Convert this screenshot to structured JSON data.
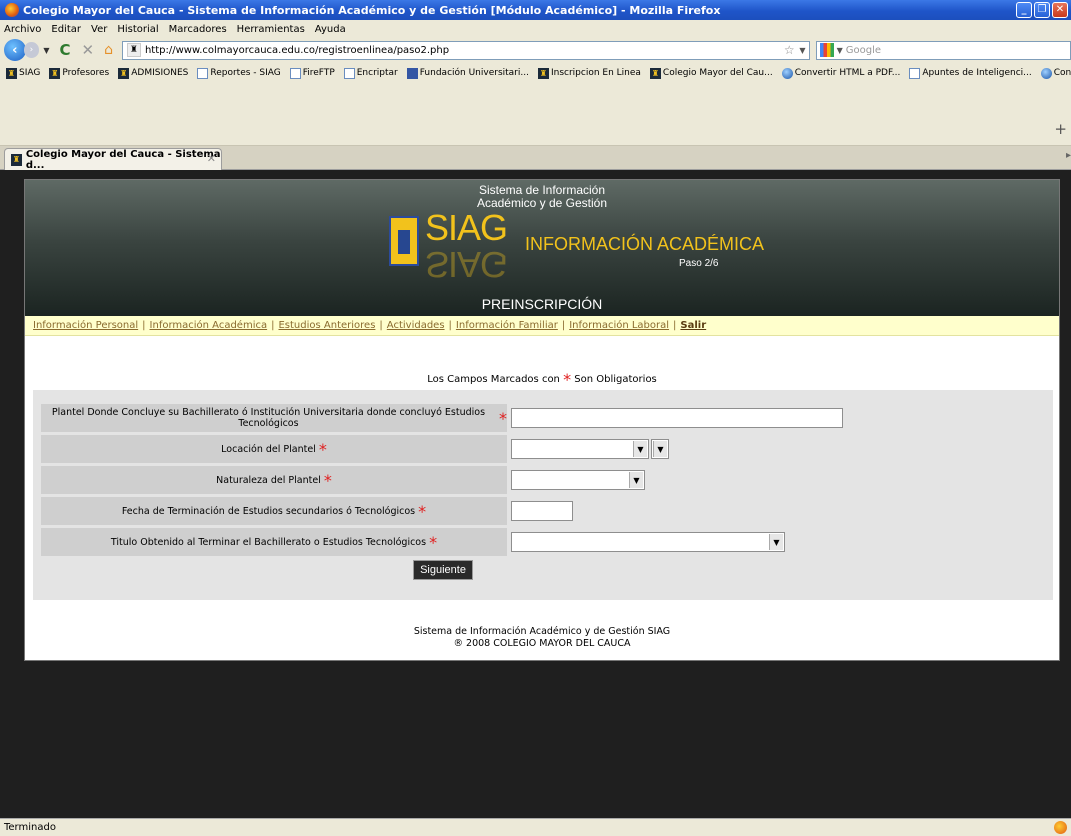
{
  "window": {
    "title": "Colegio Mayor del Cauca - Sistema de Información Académico y de Gestión [Módulo Académico] - Mozilla Firefox"
  },
  "menubar": {
    "items": [
      "Archivo",
      "Editar",
      "Ver",
      "Historial",
      "Marcadores",
      "Herramientas",
      "Ayuda"
    ]
  },
  "navbar": {
    "url": "http://www.colmayorcauca.edu.co/registroenlinea/paso2.php",
    "search_placeholder": "Google"
  },
  "bookmarks": [
    {
      "label": "SIAG",
      "icon": "siag-icon"
    },
    {
      "label": "Profesores",
      "icon": "siag-icon"
    },
    {
      "label": "ADMISIONES",
      "icon": "siag-icon"
    },
    {
      "label": "Reportes - SIAG",
      "icon": "page-icon"
    },
    {
      "label": "FireFTP",
      "icon": "page-icon"
    },
    {
      "label": "Encriptar",
      "icon": "page-icon"
    },
    {
      "label": "Fundación Universitari...",
      "icon": "grid-icon"
    },
    {
      "label": "Inscripcion En Linea",
      "icon": "siag-icon"
    },
    {
      "label": "Colegio Mayor del Cau...",
      "icon": "siag-icon"
    },
    {
      "label": "Convertir HTML a PDF...",
      "icon": "globe-icon"
    },
    {
      "label": "Apuntes de Inteligenci...",
      "icon": "page-icon"
    },
    {
      "label": "Convertir HTML a PDF...",
      "icon": "globe-icon"
    }
  ],
  "tab": {
    "label": "Colegio Mayor del Cauca - Sistema d..."
  },
  "banner": {
    "sys_line1": "Sistema de Información",
    "sys_line2": "Académico y de Gestión",
    "logo_text": "SIAG",
    "section": "INFORMACIÓN ACADÉMICA",
    "step": "Paso 2/6",
    "subtitle": "PREINSCRIPCIÓN"
  },
  "navlinks": [
    "Información Personal",
    "Información Académica",
    "Estudios Anteriores",
    "Actividades",
    "Información Familiar",
    "Información Laboral",
    "Salir"
  ],
  "form": {
    "mandatory_prefix": "Los Campos Marcados con",
    "mandatory_suffix": "Son Obligatorios",
    "req_mark": "*",
    "fields": [
      {
        "label": "Plantel Donde Concluye su Bachillerato ó Institución Universitaria donde concluyó Estudios Tecnológicos",
        "value": ""
      },
      {
        "label": "Locación del Plantel",
        "value": ""
      },
      {
        "label": "Naturaleza del Plantel",
        "value": ""
      },
      {
        "label": "Fecha de Terminación de Estudios secundarios ó Tecnológicos",
        "value": ""
      },
      {
        "label": "Titulo Obtenido al Terminar el Bachillerato o Estudios Tecnológicos",
        "value": ""
      }
    ],
    "submit_label": "Siguiente"
  },
  "footer": {
    "line1": "Sistema de Información Académico y de Gestión SIAG",
    "line2": "® 2008 COLEGIO MAYOR DEL CAUCA"
  },
  "status": {
    "text": "Terminado"
  }
}
